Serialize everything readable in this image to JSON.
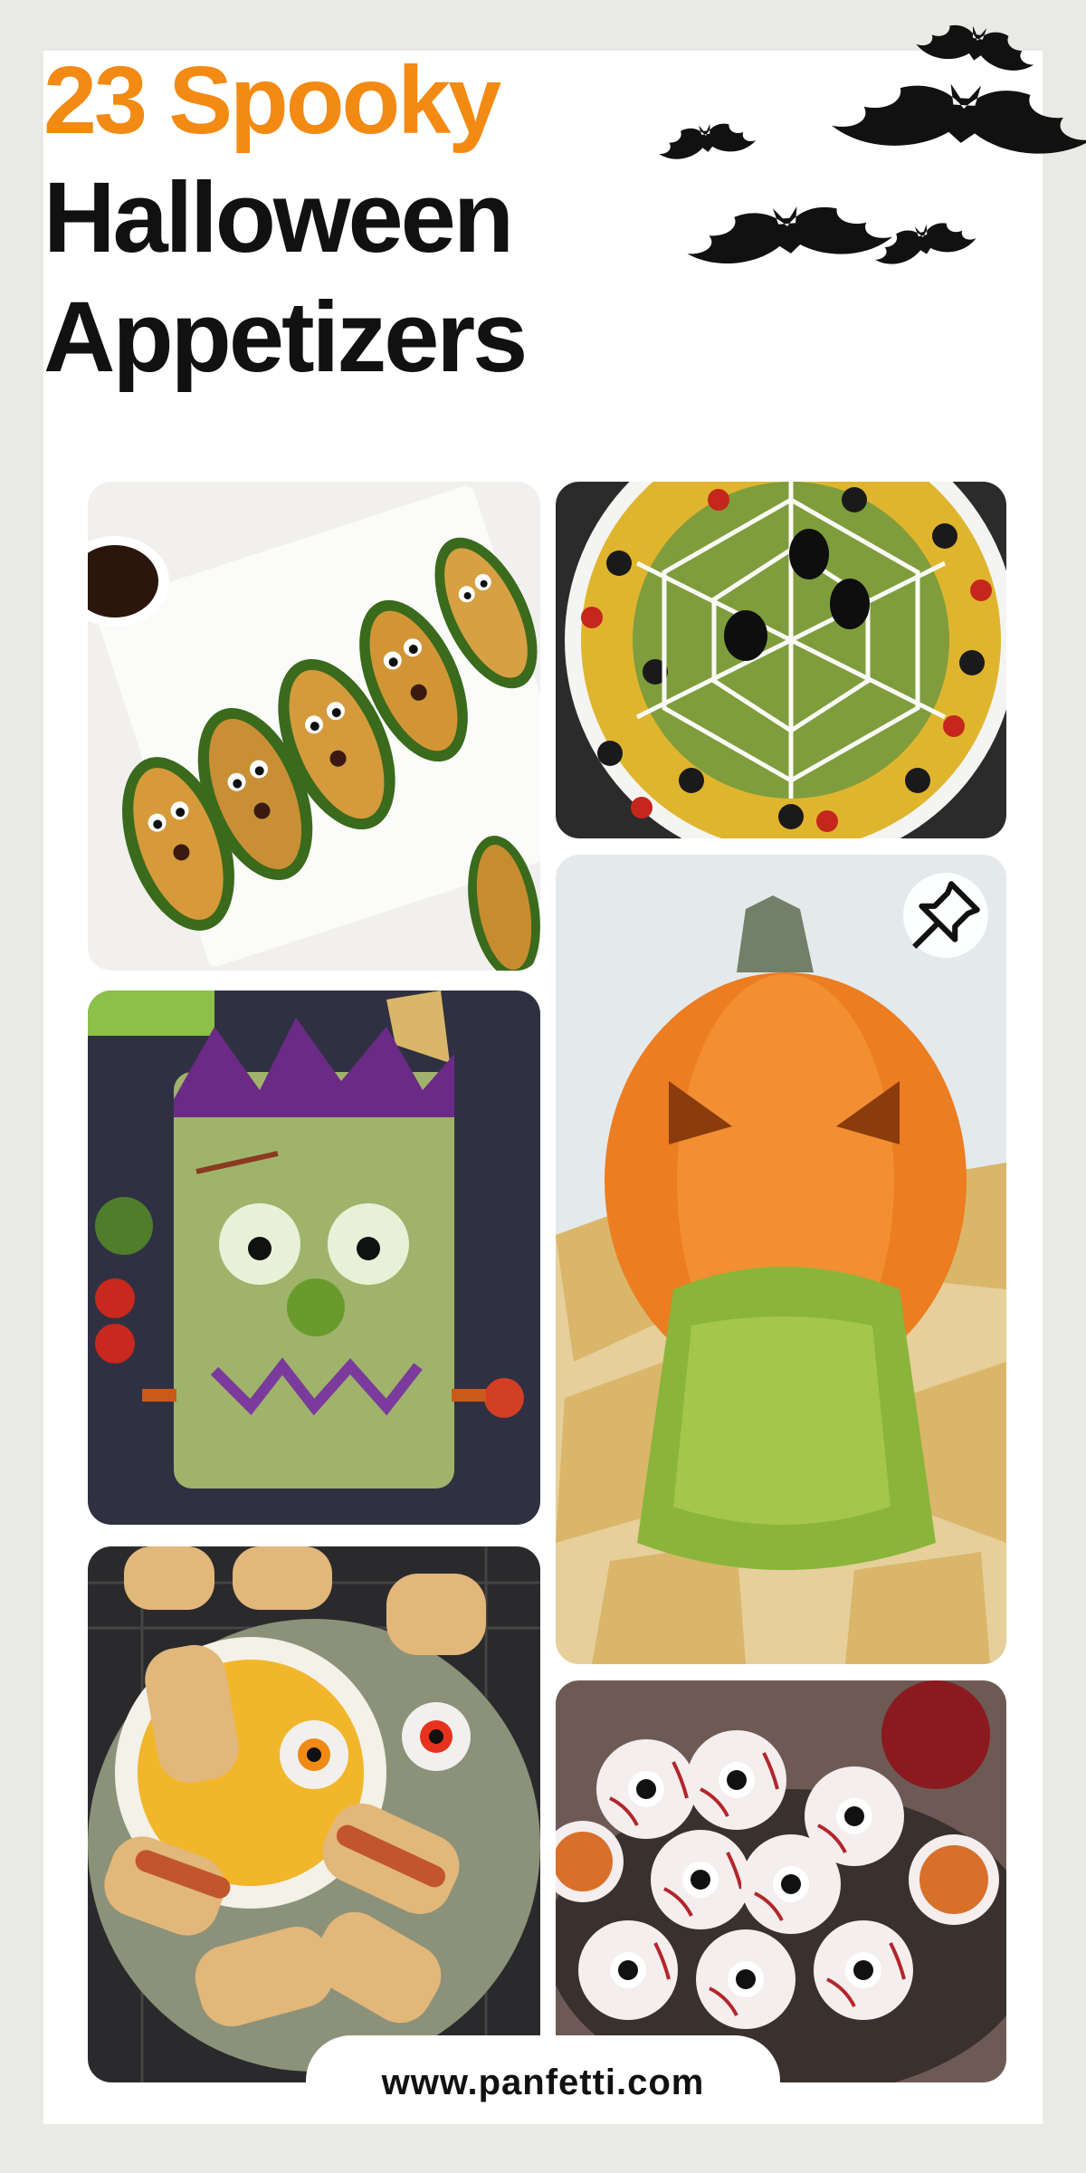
{
  "title": {
    "line1": "23 Spooky",
    "line2": "Halloween",
    "line3": "Appetizers"
  },
  "colors": {
    "accent": "#f28a13",
    "heading": "#111111",
    "background": "#e9e9e6"
  },
  "photos": [
    {
      "name": "jalapeno-poppers-photo"
    },
    {
      "name": "spiderweb-taco-dip-photo"
    },
    {
      "name": "frankenstein-guacamole-photo"
    },
    {
      "name": "puking-pumpkin-guacamole-photo"
    },
    {
      "name": "mummy-dogs-cheese-dip-photo"
    },
    {
      "name": "eyeball-cake-balls-photo"
    }
  ],
  "pin_icon": "pushpin-icon",
  "website": "www.panfetti.com"
}
